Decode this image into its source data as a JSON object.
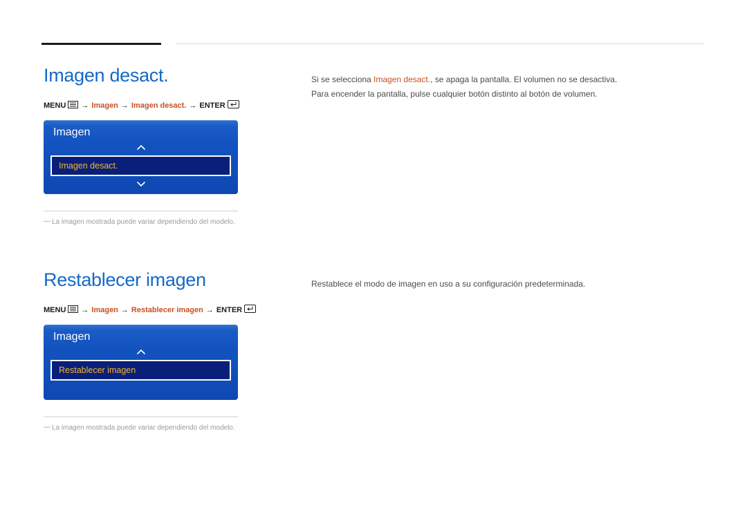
{
  "section1": {
    "title": "Imagen desact.",
    "path": {
      "menu_label": "MENU",
      "step1": "Imagen",
      "step2": "Imagen desact.",
      "enter_label": "ENTER"
    },
    "osd": {
      "panel_title": "Imagen",
      "selected_item": "Imagen desact."
    },
    "footnote": "La imagen mostrada puede variar dependiendo del modelo.",
    "body": {
      "line1_pre": "Si se selecciona ",
      "line1_hl": "Imagen desact.",
      "line1_post": ", se apaga la pantalla. El volumen no se desactiva.",
      "line2": "Para encender la pantalla, pulse cualquier botón distinto al botón de volumen."
    }
  },
  "section2": {
    "title": "Restablecer imagen",
    "path": {
      "menu_label": "MENU",
      "step1": "Imagen",
      "step2": "Restablecer imagen",
      "enter_label": "ENTER"
    },
    "osd": {
      "panel_title": "Imagen",
      "selected_item": "Restablecer imagen"
    },
    "footnote": "La imagen mostrada puede variar dependiendo del modelo.",
    "body": {
      "line1": "Restablece el modo de imagen en uso a su configuración predeterminada."
    }
  }
}
